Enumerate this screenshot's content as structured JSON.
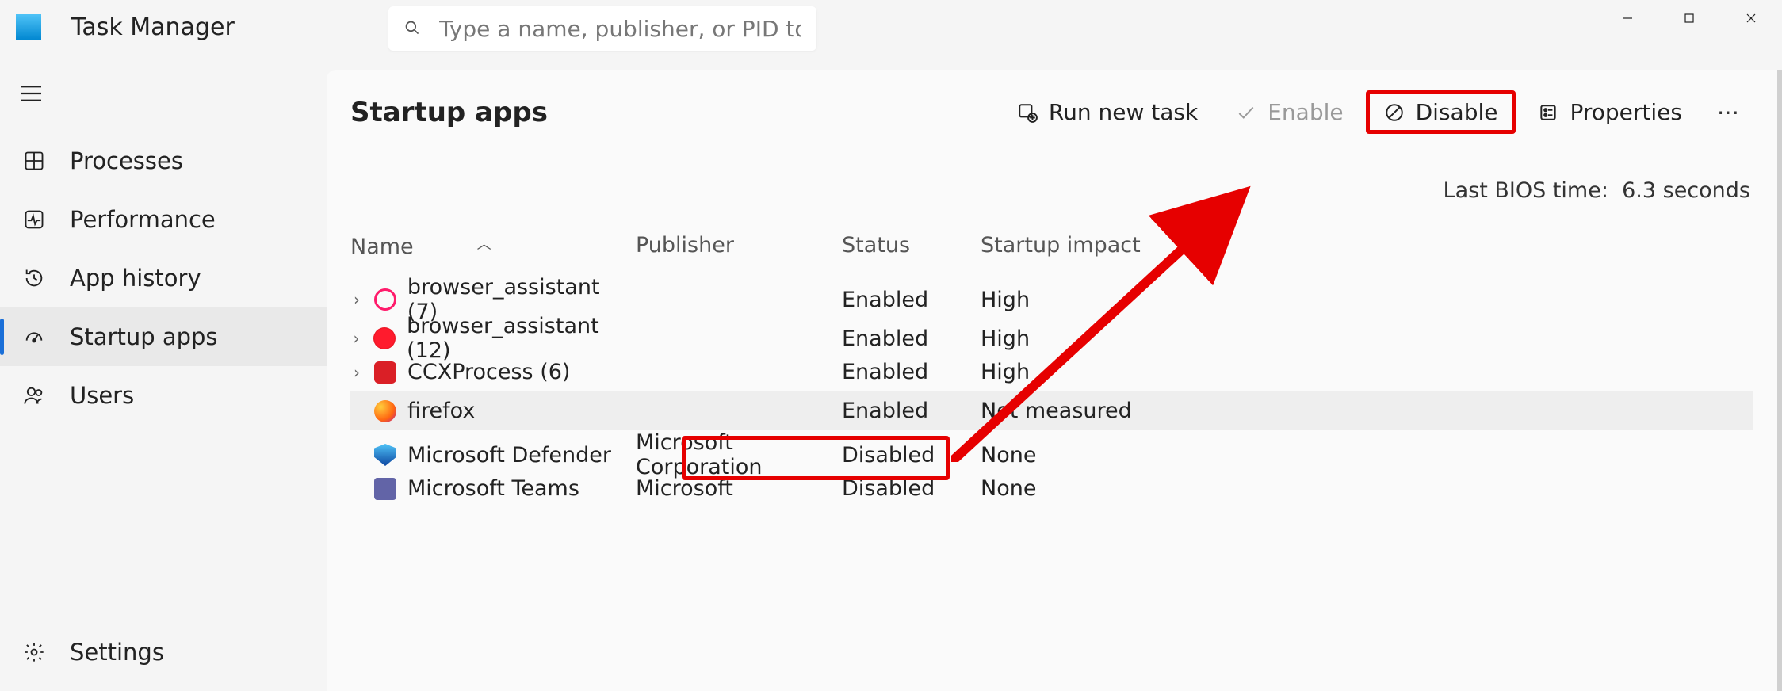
{
  "app": {
    "title": "Task Manager"
  },
  "search": {
    "placeholder": "Type a name, publisher, or PID to search"
  },
  "sidebar": {
    "items": [
      {
        "label": "Processes"
      },
      {
        "label": "Performance"
      },
      {
        "label": "App history"
      },
      {
        "label": "Startup apps"
      },
      {
        "label": "Users"
      }
    ],
    "settings": "Settings"
  },
  "page": {
    "title": "Startup apps",
    "toolbar": {
      "run": "Run new task",
      "enable": "Enable",
      "disable": "Disable",
      "properties": "Properties"
    },
    "bios_label": "Last BIOS time:",
    "bios_value": "6.3 seconds"
  },
  "table": {
    "columns": {
      "name": "Name",
      "publisher": "Publisher",
      "status": "Status",
      "impact": "Startup impact"
    },
    "rows": [
      {
        "name": "browser_assistant (7)",
        "publisher": "",
        "status": "Enabled",
        "impact": "High",
        "expandable": true,
        "icon": "opera1"
      },
      {
        "name": "browser_assistant (12)",
        "publisher": "",
        "status": "Enabled",
        "impact": "High",
        "expandable": true,
        "icon": "opera2"
      },
      {
        "name": "CCXProcess (6)",
        "publisher": "",
        "status": "Enabled",
        "impact": "High",
        "expandable": true,
        "icon": "cc"
      },
      {
        "name": "firefox",
        "publisher": "",
        "status": "Enabled",
        "impact": "Not measured",
        "expandable": false,
        "icon": "firefox",
        "selected": true
      },
      {
        "name": "Microsoft Defender",
        "publisher": "Microsoft Corporation",
        "status": "Disabled",
        "impact": "None",
        "expandable": false,
        "icon": "defender"
      },
      {
        "name": "Microsoft Teams",
        "publisher": "Microsoft",
        "status": "Disabled",
        "impact": "None",
        "expandable": false,
        "icon": "teams"
      }
    ]
  }
}
